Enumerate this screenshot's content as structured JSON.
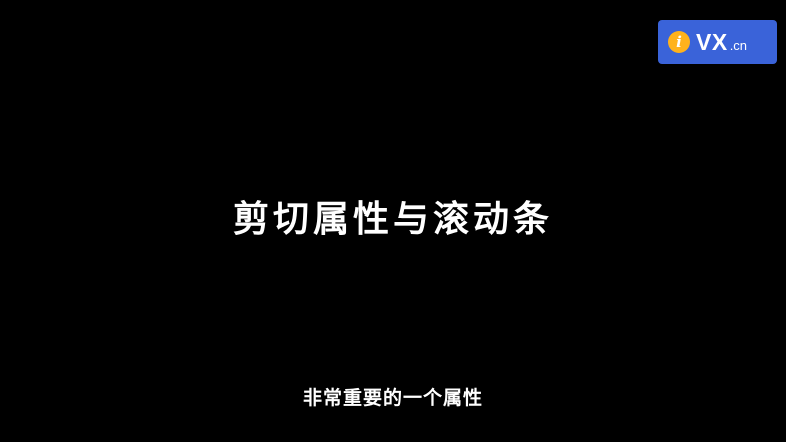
{
  "logo": {
    "i_letter": "i",
    "brand": "VX",
    "suffix": ".cn",
    "colors": {
      "badge_background": "#3a63d9",
      "i_circle": "#ffb21c",
      "text": "#ffffff"
    }
  },
  "slide": {
    "title": "剪切属性与滚动条",
    "background_color": "#000000",
    "text_color": "#ffffff"
  },
  "subtitle": {
    "text": "非常重要的一个属性"
  }
}
